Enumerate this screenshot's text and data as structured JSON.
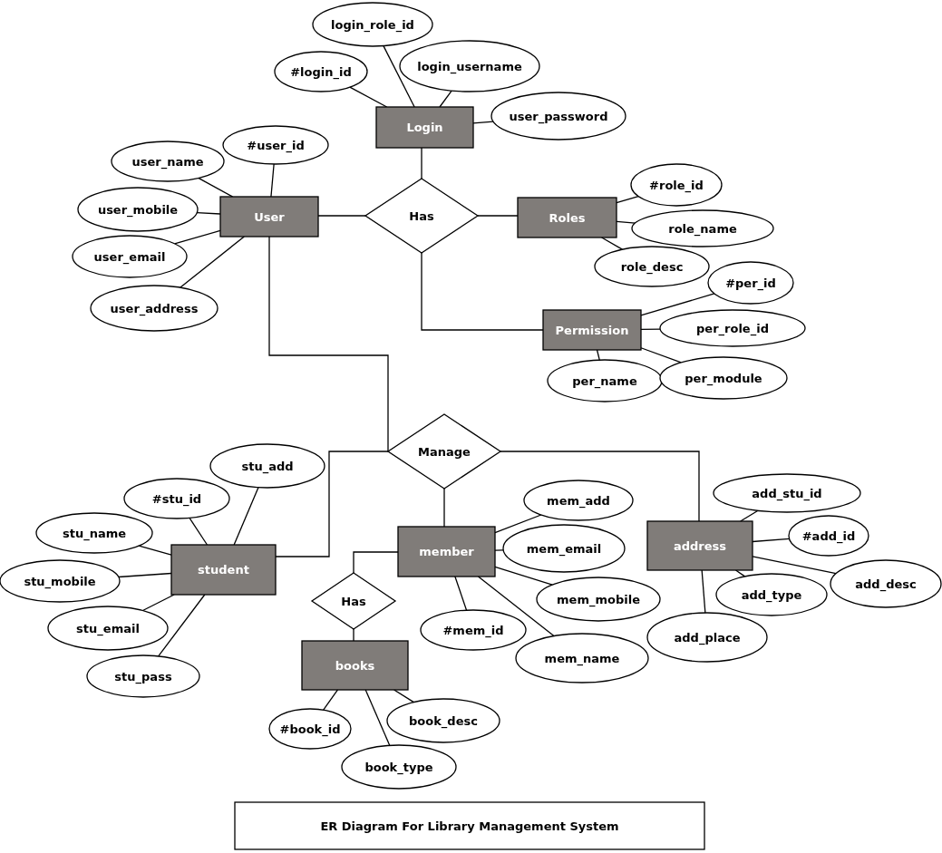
{
  "entities": [
    {
      "name": "Login",
      "attributes": [
        "login_role_id",
        "#login_id",
        "login_username",
        "user_password"
      ]
    },
    {
      "name": "User",
      "attributes": [
        "#user_id",
        "user_name",
        "user_mobile",
        "user_email",
        "user_address"
      ]
    },
    {
      "name": "Roles",
      "attributes": [
        "#role_id",
        "role_name",
        "role_desc"
      ]
    },
    {
      "name": "Permission",
      "attributes": [
        "#per_id",
        "per_role_id",
        "per_name",
        "per_module"
      ]
    },
    {
      "name": "student",
      "attributes": [
        "stu_add",
        "#stu_id",
        "stu_name",
        "stu_mobile",
        "stu_email",
        "stu_pass"
      ]
    },
    {
      "name": "member",
      "attributes": [
        "mem_add",
        "mem_email",
        "mem_mobile",
        "mem_name",
        "#mem_id"
      ]
    },
    {
      "name": "address",
      "attributes": [
        "add_stu_id",
        "#add_id",
        "add_desc",
        "add_type",
        "add_place"
      ]
    },
    {
      "name": "books",
      "attributes": [
        "#book_id",
        "book_desc",
        "book_type"
      ]
    }
  ],
  "relationships": [
    {
      "name": "Has"
    },
    {
      "name": "Manage"
    },
    {
      "name": "Has"
    }
  ],
  "caption": "ER Diagram For Library Management System"
}
